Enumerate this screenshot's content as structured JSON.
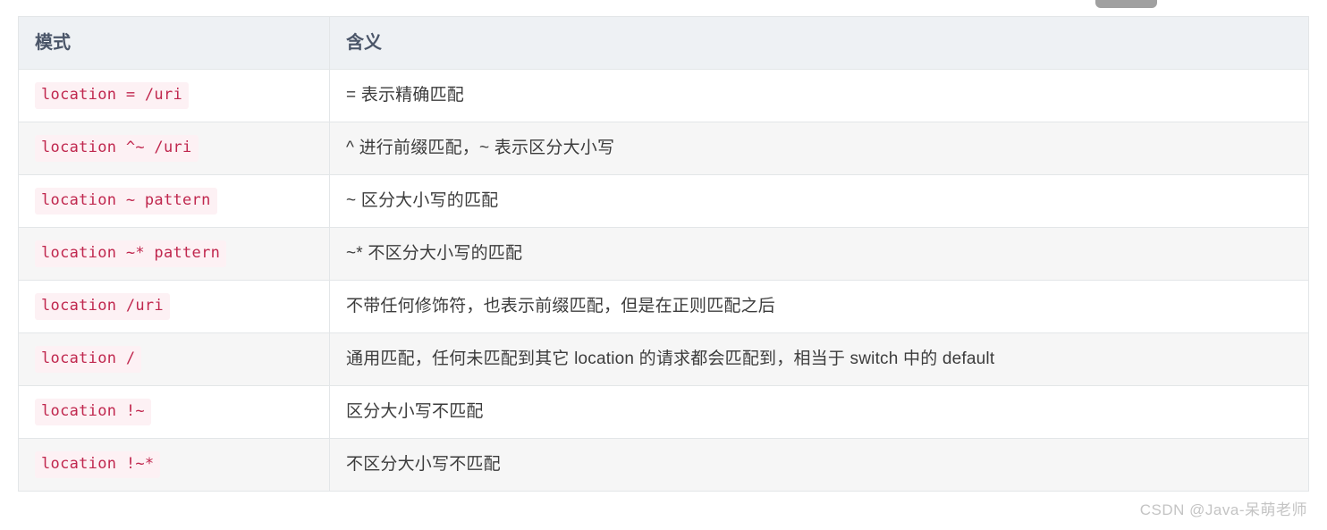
{
  "watermark": "CSDN @Java-呆萌老师",
  "table": {
    "headers": {
      "mode": "模式",
      "meaning": "含义"
    },
    "rows": [
      {
        "mode": "location = /uri",
        "meaning": "= 表示精确匹配"
      },
      {
        "mode": "location ^~ /uri",
        "meaning": "^ 进行前缀匹配，~ 表示区分大小写"
      },
      {
        "mode": "location ~ pattern",
        "meaning": "~ 区分大小写的匹配"
      },
      {
        "mode": "location ~* pattern",
        "meaning": "~* 不区分大小写的匹配"
      },
      {
        "mode": "location /uri",
        "meaning": "不带任何修饰符，也表示前缀匹配，但是在正则匹配之后"
      },
      {
        "mode": "location /",
        "meaning": "通用匹配，任何未匹配到其它 location 的请求都会匹配到，相当于 switch 中的 default"
      },
      {
        "mode": "location !~",
        "meaning": "区分大小写不匹配"
      },
      {
        "mode": "location !~*",
        "meaning": "不区分大小写不匹配"
      }
    ]
  },
  "colors": {
    "header_bg": "#eef1f4",
    "header_text": "#4a5568",
    "code_text": "#c0274e",
    "code_bg": "#fdf1f4",
    "row_alt_bg": "#f6f6f6",
    "border": "#e3e6e8",
    "watermark_text": "#c4c4c4",
    "top_pill": "#a0a0a0"
  }
}
